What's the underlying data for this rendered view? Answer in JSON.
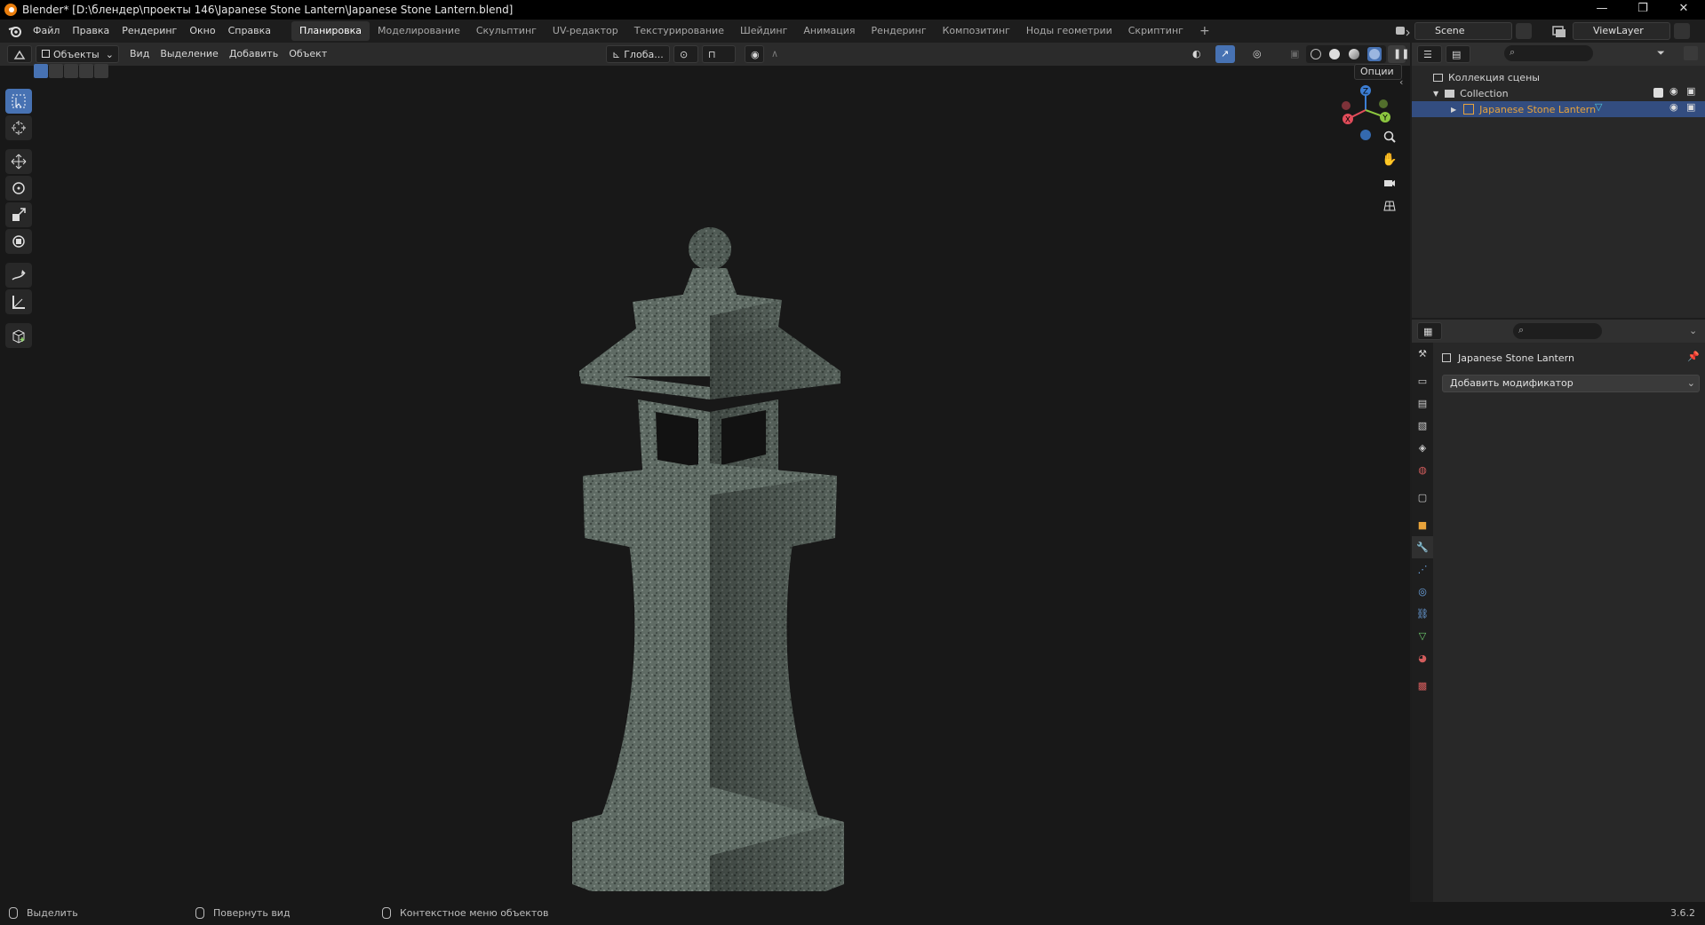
{
  "window": {
    "title": "Blender* [D:\\блендер\\проекты 146\\Japanese Stone Lantern\\Japanese Stone Lantern.blend]",
    "minimize": "—",
    "restore": "❐",
    "close": "✕"
  },
  "menu": {
    "items": [
      "Файл",
      "Правка",
      "Рендеринг",
      "Окно",
      "Справка"
    ],
    "workspaces": [
      "Планировка",
      "Моделирование",
      "Скульптинг",
      "UV-редактор",
      "Текстурирование",
      "Шейдинг",
      "Анимация",
      "Рендеринг",
      "Композитинг",
      "Ноды геометрии",
      "Скриптинг"
    ],
    "active_workspace": 0,
    "add_workspace": "+",
    "scene": "Scene",
    "view_layer": "ViewLayer"
  },
  "viewport_header": {
    "mode": "Объекты",
    "menus": [
      "Вид",
      "Выделение",
      "Добавить",
      "Объект"
    ],
    "orientation": "Глоба...",
    "options": "Опции"
  },
  "gizmo": {
    "x": "X",
    "y": "Y",
    "z": "Z"
  },
  "outliner": {
    "scene_collection": "Коллекция сцены",
    "collection": "Collection",
    "object": "Japanese Stone Lantern"
  },
  "properties": {
    "object_name": "Japanese Stone Lantern",
    "add_modifier": "Добавить модификатор"
  },
  "status": {
    "select": "Выделить",
    "rotate": "Повернуть вид",
    "context": "Контекстное меню объектов",
    "version": "3.6.2"
  },
  "colors": {
    "accent": "#4772b3",
    "selected_row": "#334d80",
    "object_orange": "#e8a33b",
    "stone": "#5f6b64"
  }
}
